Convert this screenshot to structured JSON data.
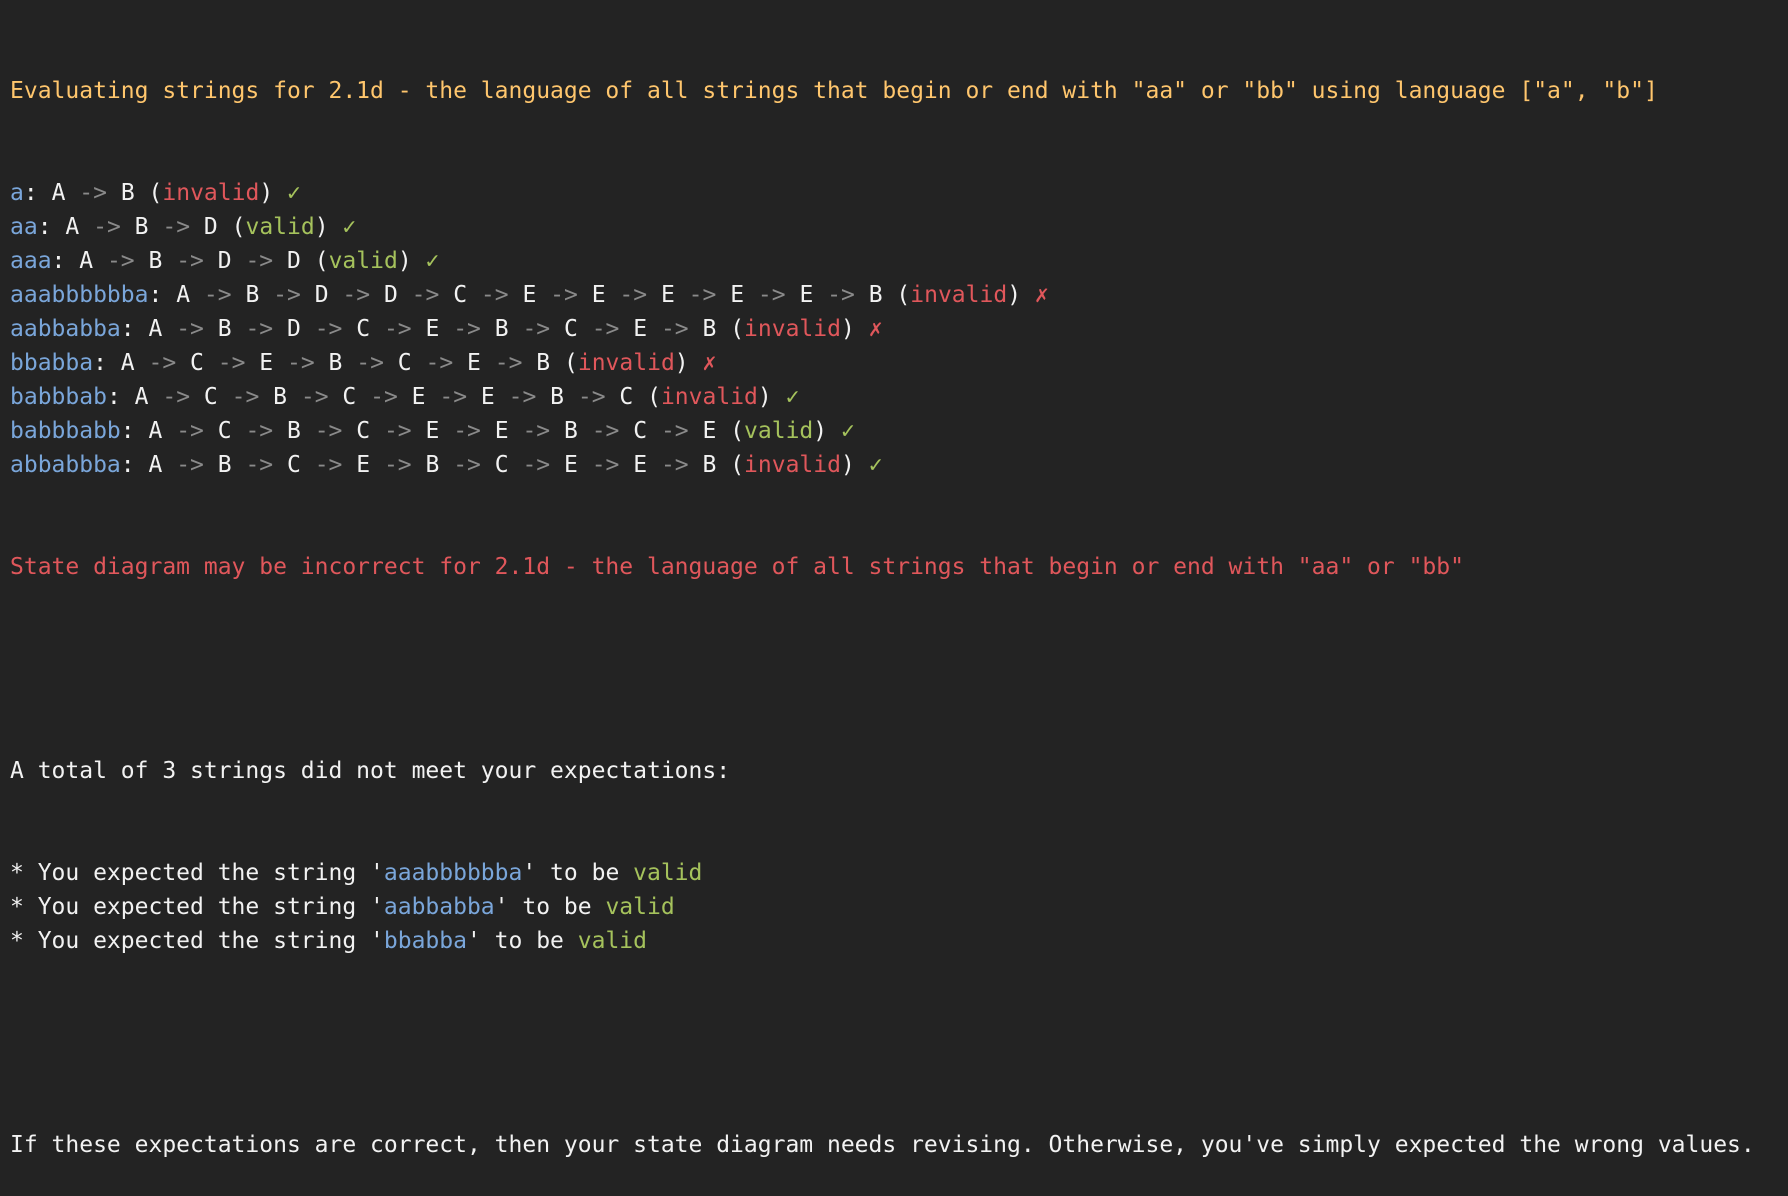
{
  "colors": {
    "background": "#232323",
    "text": "#f2f2f2",
    "header": "#ffc66d",
    "string": "#7aa6da",
    "arrow": "#8a8a8a",
    "valid": "#a5c25c",
    "invalid": "#e0575b"
  },
  "header": "Evaluating strings for 2.1d - the language of all strings that begin or end with \"aa\" or \"bb\" using language [\"a\", \"b\"]",
  "arrow": "->",
  "results": [
    {
      "string": "a",
      "states": [
        "A",
        "B"
      ],
      "verdict": "invalid",
      "mark": "✓",
      "mark_color": "valid"
    },
    {
      "string": "aa",
      "states": [
        "A",
        "B",
        "D"
      ],
      "verdict": "valid",
      "mark": "✓",
      "mark_color": "valid"
    },
    {
      "string": "aaa",
      "states": [
        "A",
        "B",
        "D",
        "D"
      ],
      "verdict": "valid",
      "mark": "✓",
      "mark_color": "valid"
    },
    {
      "string": "aaabbbbbba",
      "states": [
        "A",
        "B",
        "D",
        "D",
        "C",
        "E",
        "E",
        "E",
        "E",
        "E",
        "B"
      ],
      "verdict": "invalid",
      "mark": "✗",
      "mark_color": "invalid"
    },
    {
      "string": "aabbabba",
      "states": [
        "A",
        "B",
        "D",
        "C",
        "E",
        "B",
        "C",
        "E",
        "B"
      ],
      "verdict": "invalid",
      "mark": "✗",
      "mark_color": "invalid"
    },
    {
      "string": "bbabba",
      "states": [
        "A",
        "C",
        "E",
        "B",
        "C",
        "E",
        "B"
      ],
      "verdict": "invalid",
      "mark": "✗",
      "mark_color": "invalid"
    },
    {
      "string": "babbbab",
      "states": [
        "A",
        "C",
        "B",
        "C",
        "E",
        "E",
        "B",
        "C"
      ],
      "verdict": "invalid",
      "mark": "✓",
      "mark_color": "valid"
    },
    {
      "string": "babbbabb",
      "states": [
        "A",
        "C",
        "B",
        "C",
        "E",
        "E",
        "B",
        "C",
        "E"
      ],
      "verdict": "valid",
      "mark": "✓",
      "mark_color": "valid"
    },
    {
      "string": "abbabbba",
      "states": [
        "A",
        "B",
        "C",
        "E",
        "B",
        "C",
        "E",
        "E",
        "B"
      ],
      "verdict": "invalid",
      "mark": "✓",
      "mark_color": "valid"
    }
  ],
  "warning": "State diagram may be incorrect for 2.1d - the language of all strings that begin or end with \"aa\" or \"bb\"",
  "summary": "A total of 3 strings did not meet your expectations:",
  "expectations": [
    {
      "prefix": "* You expected the string '",
      "string": "aaabbbbbba",
      "middle": "' to be ",
      "value": "valid"
    },
    {
      "prefix": "* You expected the string '",
      "string": "aabbabba",
      "middle": "' to be ",
      "value": "valid"
    },
    {
      "prefix": "* You expected the string '",
      "string": "bbabba",
      "middle": "' to be ",
      "value": "valid"
    }
  ],
  "footer": "If these expectations are correct, then your state diagram needs revising. Otherwise, you've simply expected the wrong values."
}
